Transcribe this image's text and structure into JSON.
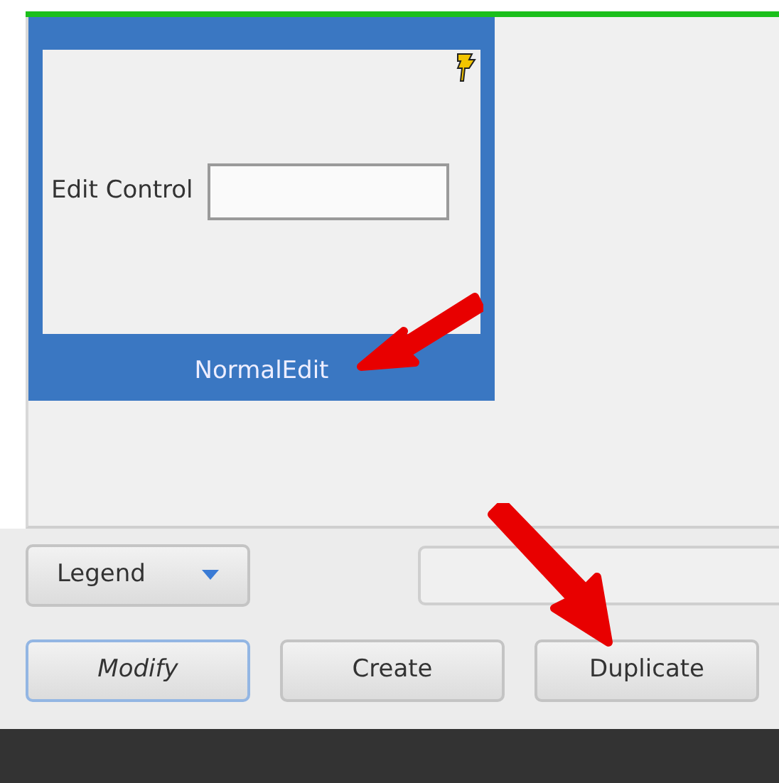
{
  "tile": {
    "label": "NormalEdit",
    "selected": true,
    "field_label": "Edit Control"
  },
  "legend_dropdown": {
    "label": "Legend"
  },
  "buttons": [
    {
      "label": "Modify",
      "focused": true
    },
    {
      "label": "Create",
      "focused": false
    },
    {
      "label": "Duplicate",
      "focused": false
    }
  ]
}
